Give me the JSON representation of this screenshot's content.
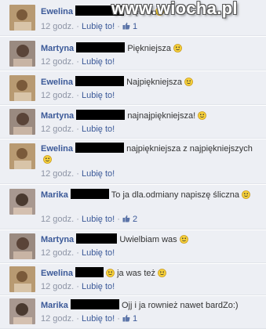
{
  "watermark": "www.wiocha.pl",
  "colors": {
    "name": "#3b5998",
    "meta": "#8d94a5",
    "background": "#edeff4"
  },
  "like_label": "Lubię to!",
  "comments": [
    {
      "name": "Ewelina",
      "text": "Piękna",
      "time": "12 godz.",
      "likes": "1",
      "smiley": true
    },
    {
      "name": "Martyna",
      "text": "Piękniejsza",
      "time": "12 godz.",
      "likes": "",
      "smiley": true
    },
    {
      "name": "Ewelina",
      "text": "Najpiękniejsza",
      "time": "12 godz.",
      "likes": "",
      "smiley": true
    },
    {
      "name": "Martyna",
      "text": "najnajpiękniejsza!",
      "time": "12 godz.",
      "likes": "",
      "smiley": true
    },
    {
      "name": "Ewelina",
      "text": "najpiękniejsza z najpiękniejszych",
      "time": "12 godz.",
      "likes": "",
      "smiley": true
    },
    {
      "name": "Marika",
      "text": "To ja dla.odmiany napiszę śliczna",
      "time": "12 godz.",
      "likes": "2",
      "smiley": true
    },
    {
      "name": "Martyna",
      "text": "Uwielbiam was",
      "time": "12 godz.",
      "likes": "",
      "smiley": true
    },
    {
      "name": "Ewelina",
      "text": "ja was też",
      "time": "12 godz.",
      "likes": "",
      "smiley": true
    },
    {
      "name": "Marika",
      "text": "Ojj i ja rownież nawet bardZo:)",
      "time": "12 godz.",
      "likes": "1",
      "smiley": false
    }
  ]
}
